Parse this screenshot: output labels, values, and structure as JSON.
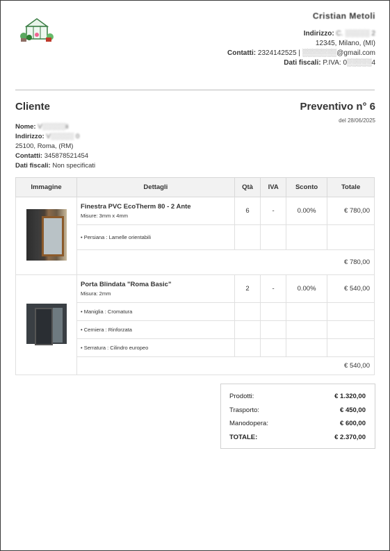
{
  "company": {
    "name": "Cristian Metoli",
    "address_label": "Indirizzo:",
    "address_line1": "C. ░░░░░ 2",
    "address_line2": "12345, Milano, (MI)",
    "contacts_label": "Contatti:",
    "contacts_value": "2324142525 | ░░░░░░░@gmail.com",
    "fiscal_label": "Dati fiscali:",
    "fiscal_value": "P.IVA: 0░░░░░4"
  },
  "client": {
    "heading": "Cliente",
    "name_label": "Nome:",
    "name_value": "V░░░░░ii",
    "address_label": "Indirizzo:",
    "address_value": "V░░░░░ 0",
    "address_line2": "25100, Roma, (RM)",
    "contacts_label": "Contatti:",
    "contacts_value": "345878521454",
    "fiscal_label": "Dati fiscali:",
    "fiscal_value": "Non specificati"
  },
  "quote": {
    "title": "Preventivo n° 6",
    "date": "del 28/06/2025"
  },
  "table": {
    "headers": [
      "Immagine",
      "Dettagli",
      "Qtà",
      "IVA",
      "Sconto",
      "Totale"
    ],
    "items": [
      {
        "name": "Finestra PVC EcoTherm 80 - 2 Ante",
        "measure": "Misure: 3mm x 4mm",
        "qty": "6",
        "iva": "-",
        "discount": "0.00%",
        "total": "€ 780,00",
        "options": [
          "• Persiana : Lamelle orientabili"
        ],
        "subtotal": "€ 780,00"
      },
      {
        "name": "Porta Blindata \"Roma Basic\"",
        "measure": "Misura: 2mm",
        "qty": "2",
        "iva": "-",
        "discount": "0.00%",
        "total": "€ 540,00",
        "options": [
          "• Maniglia : Cromatura",
          "• Cerniera : Rinforzata",
          "• Serratura : Cilindro europeo"
        ],
        "subtotal": "€ 540,00"
      }
    ]
  },
  "totals": {
    "products_label": "Prodotti:",
    "products_value": "€ 1.320,00",
    "shipping_label": "Trasporto:",
    "shipping_value": "€ 450,00",
    "labor_label": "Manodopera:",
    "labor_value": "€ 600,00",
    "total_label": "TOTALE:",
    "total_value": "€ 2.370,00"
  }
}
